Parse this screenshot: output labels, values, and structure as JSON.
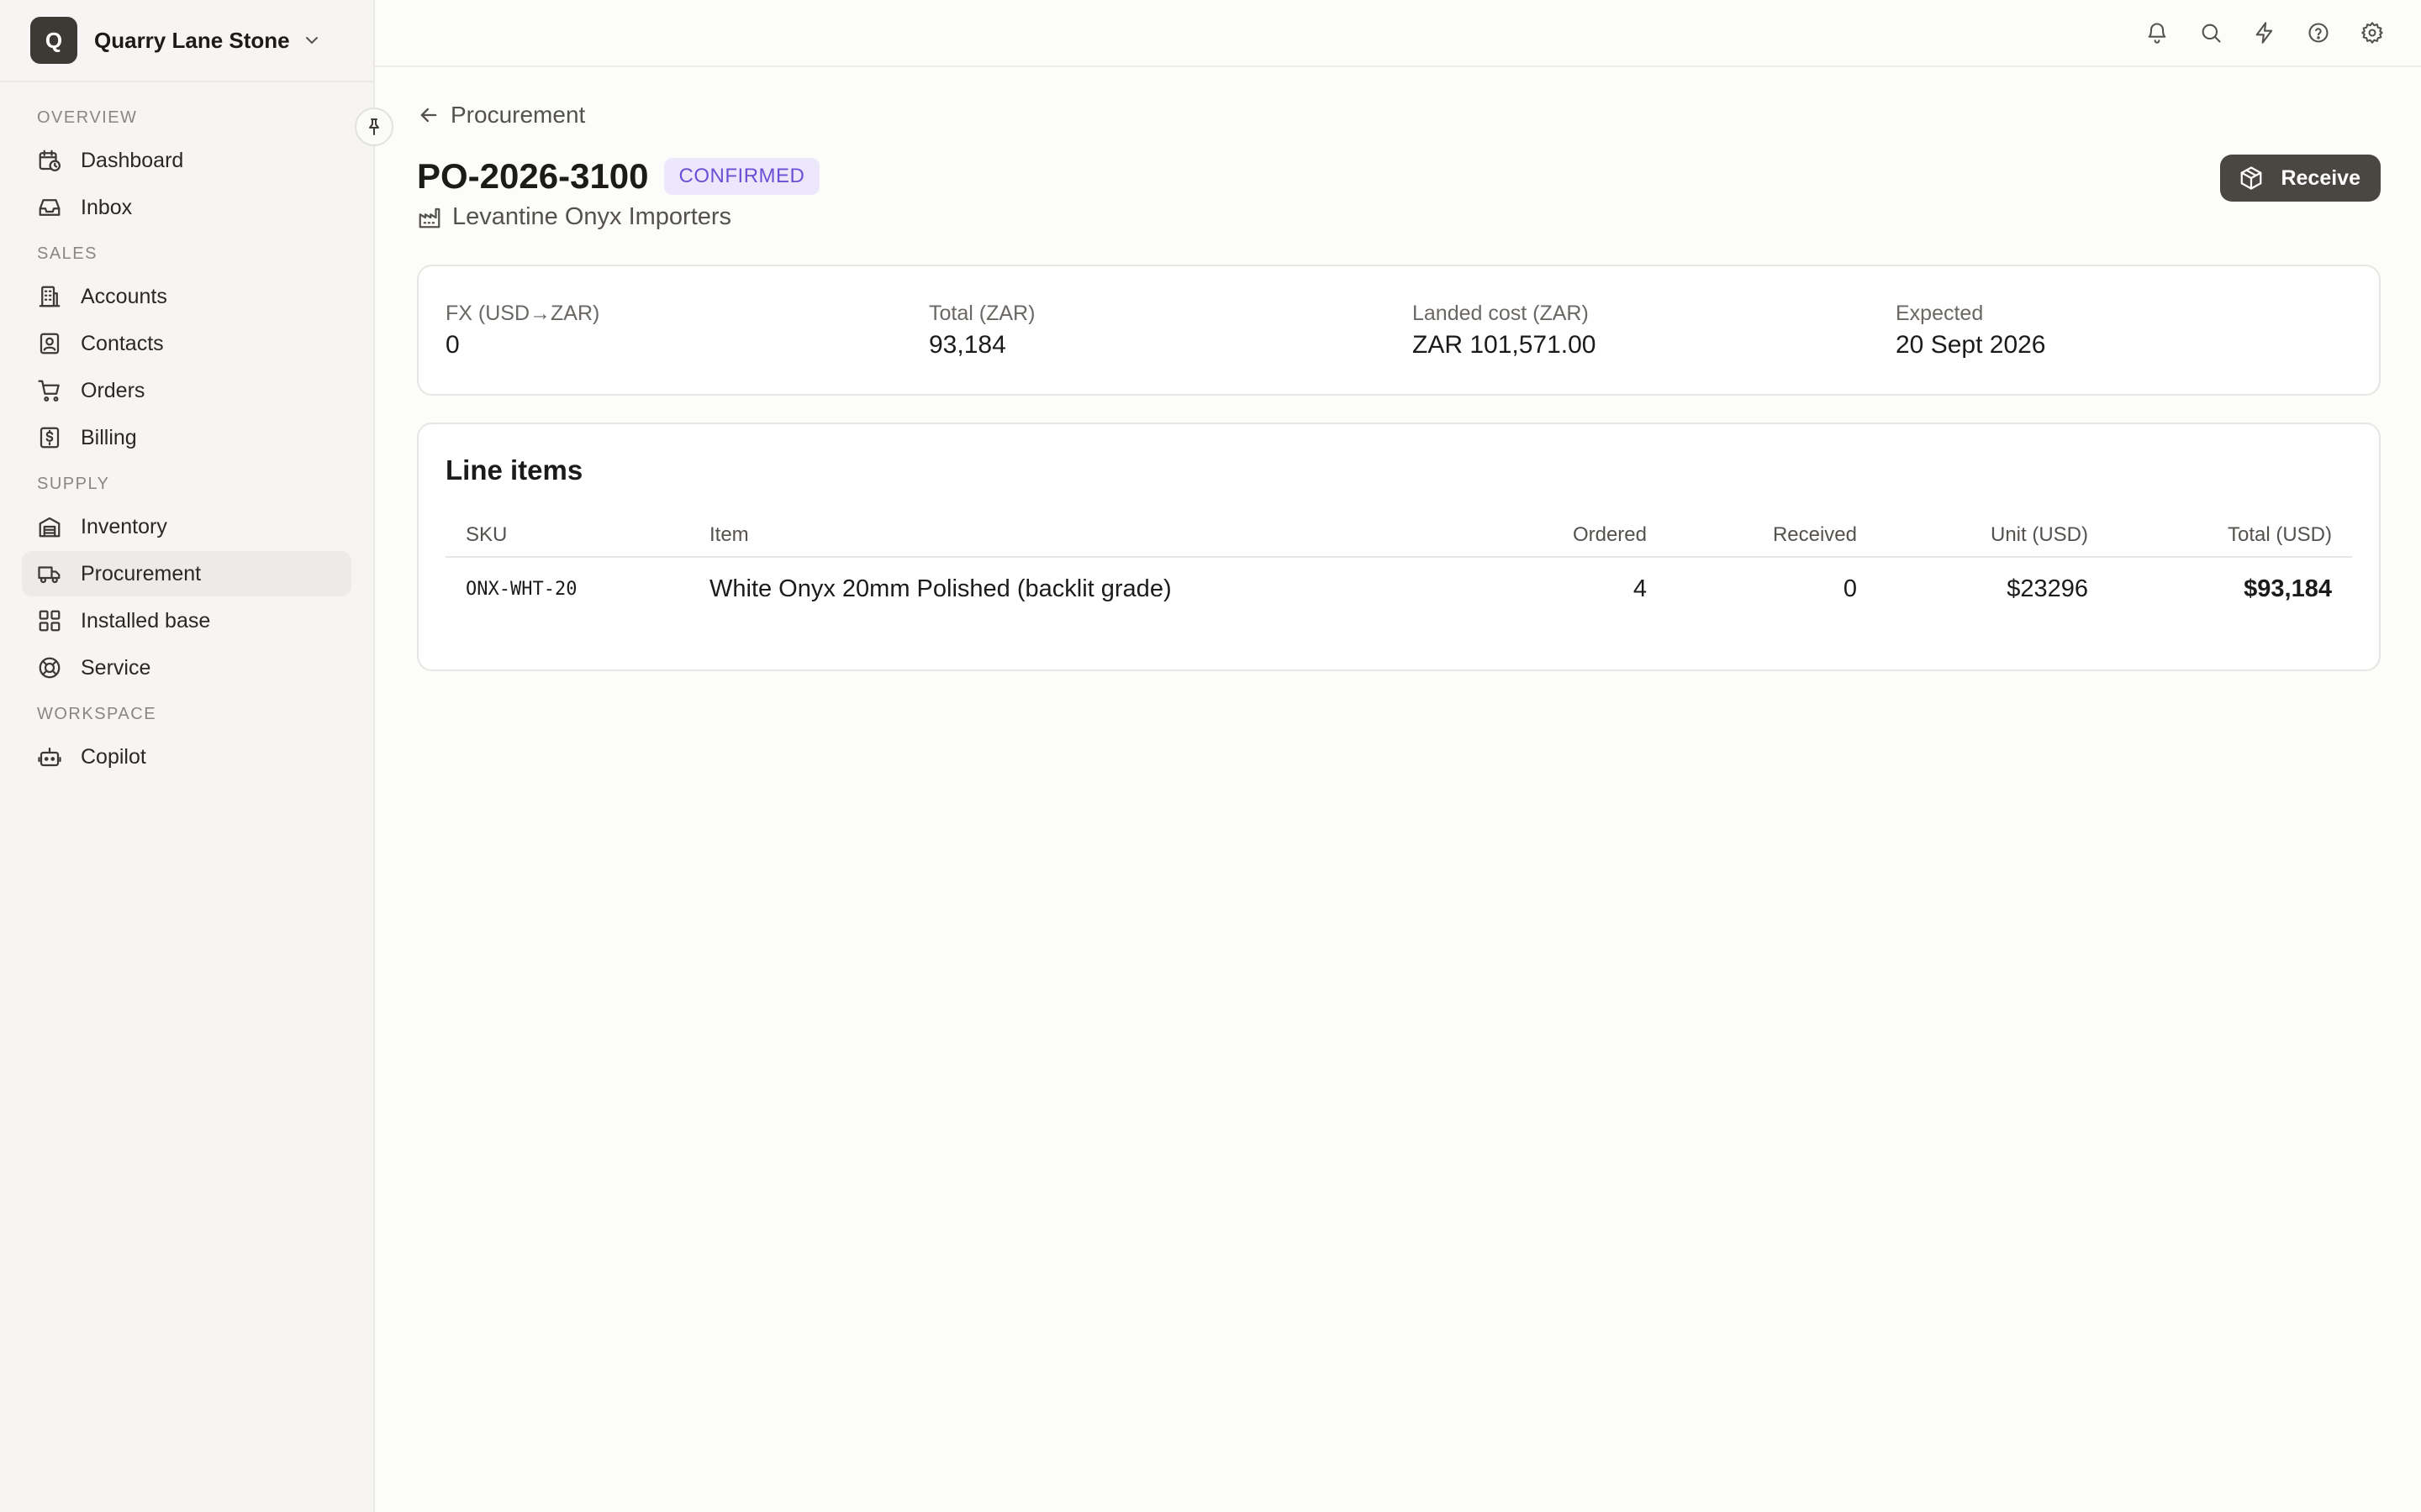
{
  "brand": {
    "initial": "Q",
    "name": "Quarry Lane Stone"
  },
  "sidebar": {
    "sections": [
      {
        "title": "OVERVIEW",
        "items": [
          {
            "label": "Dashboard",
            "icon": "calendar-clock-icon"
          },
          {
            "label": "Inbox",
            "icon": "inbox-icon"
          }
        ]
      },
      {
        "title": "SALES",
        "items": [
          {
            "label": "Accounts",
            "icon": "building-icon"
          },
          {
            "label": "Contacts",
            "icon": "contact-icon"
          },
          {
            "label": "Orders",
            "icon": "cart-icon"
          },
          {
            "label": "Billing",
            "icon": "billing-icon"
          }
        ]
      },
      {
        "title": "SUPPLY",
        "items": [
          {
            "label": "Inventory",
            "icon": "warehouse-icon"
          },
          {
            "label": "Procurement",
            "icon": "truck-icon",
            "active": true
          },
          {
            "label": "Installed base",
            "icon": "grid-icon"
          },
          {
            "label": "Service",
            "icon": "lifebuoy-icon"
          }
        ]
      },
      {
        "title": "WORKSPACE",
        "items": [
          {
            "label": "Copilot",
            "icon": "bot-icon"
          }
        ]
      }
    ]
  },
  "topbar": {
    "icons": [
      "bell-icon",
      "search-icon",
      "bolt-icon",
      "help-icon",
      "settings-icon"
    ]
  },
  "page": {
    "back_label": "Procurement",
    "po_number": "PO-2026-3100",
    "status": "CONFIRMED",
    "supplier": "Levantine Onyx Importers",
    "receive_label": "Receive"
  },
  "summary": {
    "fx": {
      "label": "FX (USD→ZAR)",
      "value": "0"
    },
    "total": {
      "label": "Total (ZAR)",
      "value": "93,184"
    },
    "landed": {
      "label": "Landed cost (ZAR)",
      "value": "ZAR 101,571.00"
    },
    "expected": {
      "label": "Expected",
      "value": "20 Sept 2026"
    }
  },
  "line_items": {
    "title": "Line items",
    "headers": {
      "sku": "SKU",
      "item": "Item",
      "ordered": "Ordered",
      "received": "Received",
      "unit": "Unit (USD)",
      "total": "Total (USD)"
    },
    "rows": [
      {
        "sku": "ONX-WHT-20",
        "item": "White Onyx 20mm Polished (backlit grade)",
        "ordered": "4",
        "received": "0",
        "unit": "$23296",
        "total": "$93,184"
      }
    ]
  },
  "colors": {
    "accent_badge_bg": "#ece7fb",
    "accent_badge_text": "#6d4fd6",
    "button_bg": "#4a4743"
  }
}
